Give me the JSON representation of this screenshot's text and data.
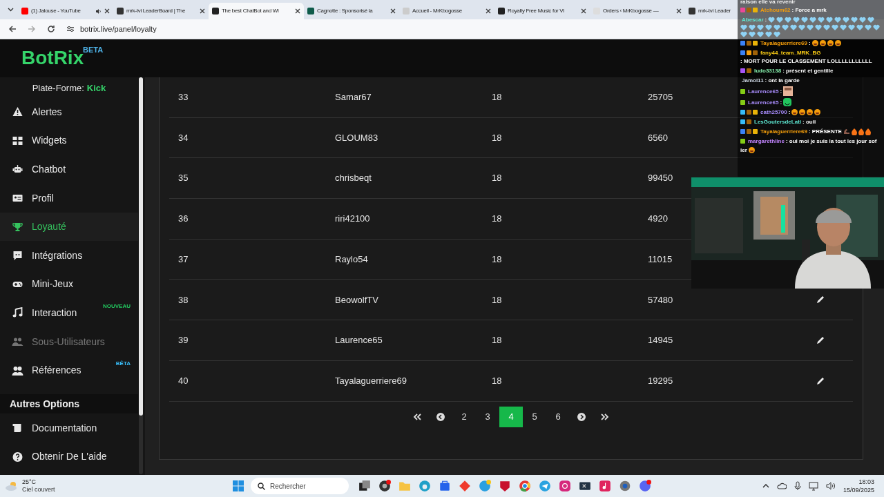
{
  "browser": {
    "tabs": [
      {
        "title": "(1) Jalouse - YouTube",
        "selected": false,
        "audio": true
      },
      {
        "title": "mrk-tvi LeaderBoard | The",
        "selected": false,
        "audio": false
      },
      {
        "title": "The best ChatBot and Wi",
        "selected": true,
        "audio": false
      },
      {
        "title": "Cagnotte : Sponsorisé la",
        "selected": false,
        "audio": false
      },
      {
        "title": "Accueil - MrKbogosse",
        "selected": false,
        "audio": false
      },
      {
        "title": "Royalty Free Music for Vi",
        "selected": false,
        "audio": false
      },
      {
        "title": "Orders ‹ MrKbogosse —",
        "selected": false,
        "audio": false
      },
      {
        "title": "mrk-tvi Leader",
        "selected": false,
        "audio": false
      }
    ],
    "url": "botrix.live/panel/loyalty"
  },
  "logo": {
    "name": "BotRix",
    "tag": "BETA"
  },
  "sidebar": {
    "platform_label": "Plate-Forme:",
    "platform": "Kick",
    "items": [
      {
        "label": "Alertes",
        "selected": false,
        "disabled": false
      },
      {
        "label": "Widgets",
        "selected": false,
        "disabled": false
      },
      {
        "label": "Chatbot",
        "selected": false,
        "disabled": false
      },
      {
        "label": "Profil",
        "selected": false,
        "disabled": false
      },
      {
        "label": "Loyauté",
        "selected": true,
        "disabled": false
      },
      {
        "label": "Intégrations",
        "selected": false,
        "disabled": false
      },
      {
        "label": "Mini-Jeux",
        "selected": false,
        "disabled": false
      },
      {
        "label": "Interaction",
        "selected": false,
        "disabled": false,
        "badge": {
          "text": "NOUVEAU",
          "color": "#22c55e"
        }
      },
      {
        "label": "Sous-Utilisateurs",
        "selected": false,
        "disabled": true
      },
      {
        "label": "Références",
        "selected": false,
        "disabled": false,
        "badge": {
          "text": "BÊTA",
          "color": "#38bdf8"
        }
      }
    ],
    "section": "Autres Options",
    "other_items": [
      {
        "label": "Documentation"
      },
      {
        "label": "Obtenir De L'aide"
      }
    ]
  },
  "table": {
    "rows": [
      [
        "33",
        "Samar67",
        "18",
        "25705"
      ],
      [
        "34",
        "GLOUM83",
        "18",
        "6560"
      ],
      [
        "35",
        "chrisbeqt",
        "18",
        "99450"
      ],
      [
        "36",
        "riri42100",
        "18",
        "4920"
      ],
      [
        "37",
        "Raylo54",
        "18",
        "11015"
      ],
      [
        "38",
        "BeowolfTV",
        "18",
        "57480"
      ],
      [
        "39",
        "Laurence65",
        "18",
        "14945"
      ],
      [
        "40",
        "Tayalaguerriere69",
        "18",
        "19295"
      ]
    ]
  },
  "pagination": {
    "pages": [
      {
        "label": "2",
        "selected": false
      },
      {
        "label": "3",
        "selected": false
      },
      {
        "label": "4",
        "selected": true
      },
      {
        "label": "5",
        "selected": false
      },
      {
        "label": "6",
        "selected": false
      }
    ]
  },
  "chat": {
    "top_text": "raison elle va revenir",
    "messages": [
      {
        "user": "Atchoum62",
        "color": "#f59e0b",
        "badges": [
          {
            "color": "#ec4899"
          },
          {
            "color": "#a16207"
          },
          {
            "color": "#eab308"
          }
        ],
        "text": ": Force a mrk"
      },
      {
        "user": "Abescar",
        "color": "#5eead4",
        "text": ":"
      },
      {
        "user": "Tayalaguerriere69",
        "color": "#f59e0b",
        "badges": [
          {
            "color": "#3b82f6"
          },
          {
            "color": "#a16207"
          },
          {
            "color": "#eab308"
          }
        ],
        "text": ":"
      },
      {
        "user": "fany44_team_MRK_BG",
        "color": "#facc15",
        "badges": [
          {
            "color": "#3b82f6"
          },
          {
            "color": "#f59e0b"
          },
          {
            "color": "#a16207"
          }
        ],
        "text": ": MORT POUR LE CLASSEMENT LOLLLLLLLLLLL"
      },
      {
        "user": "ludo33138",
        "color": "#86efac",
        "badges": [
          {
            "color": "#a855f7"
          },
          {
            "color": "#a16207"
          }
        ],
        "text": ": présent et gentille"
      },
      {
        "user": "Jamol11",
        "color": "#cbd5e1",
        "text": ": ont la garde"
      },
      {
        "user": "Laurence65",
        "color": "#a78bfa",
        "badges": [
          {
            "color": "#84cc16"
          }
        ],
        "text": ":"
      },
      {
        "user": "Laurence65",
        "color": "#a78bfa",
        "badges": [
          {
            "color": "#84cc16"
          }
        ],
        "text": ":"
      },
      {
        "user": "cath25700",
        "color": "#a78bfa",
        "badges": [
          {
            "color": "#38bdf8"
          },
          {
            "color": "#a16207"
          },
          {
            "color": "#eab308"
          }
        ],
        "text": ":"
      },
      {
        "user": "LesGoutersdeLati",
        "color": "#5eead4",
        "badges": [
          {
            "color": "#38bdf8"
          },
          {
            "color": "#a16207"
          }
        ],
        "text": ": ouii"
      },
      {
        "user": "Tayalaguerriere69",
        "color": "#f59e0b",
        "badges": [
          {
            "color": "#3b82f6"
          },
          {
            "color": "#a16207"
          },
          {
            "color": "#eab308"
          }
        ],
        "text": ": PRÉSENTE"
      },
      {
        "user": "margarethline",
        "color": "#c084fc",
        "badges": [
          {
            "color": "#84cc16"
          }
        ],
        "text": ": oui moi je suis la tout les jour sof",
        "continuation": "ier"
      }
    ]
  },
  "taskbar": {
    "temperature": "25°C",
    "weather": "Ciel couvert",
    "search_placeholder": "Rechercher",
    "time": "18:03",
    "date": "15/09/2025"
  }
}
